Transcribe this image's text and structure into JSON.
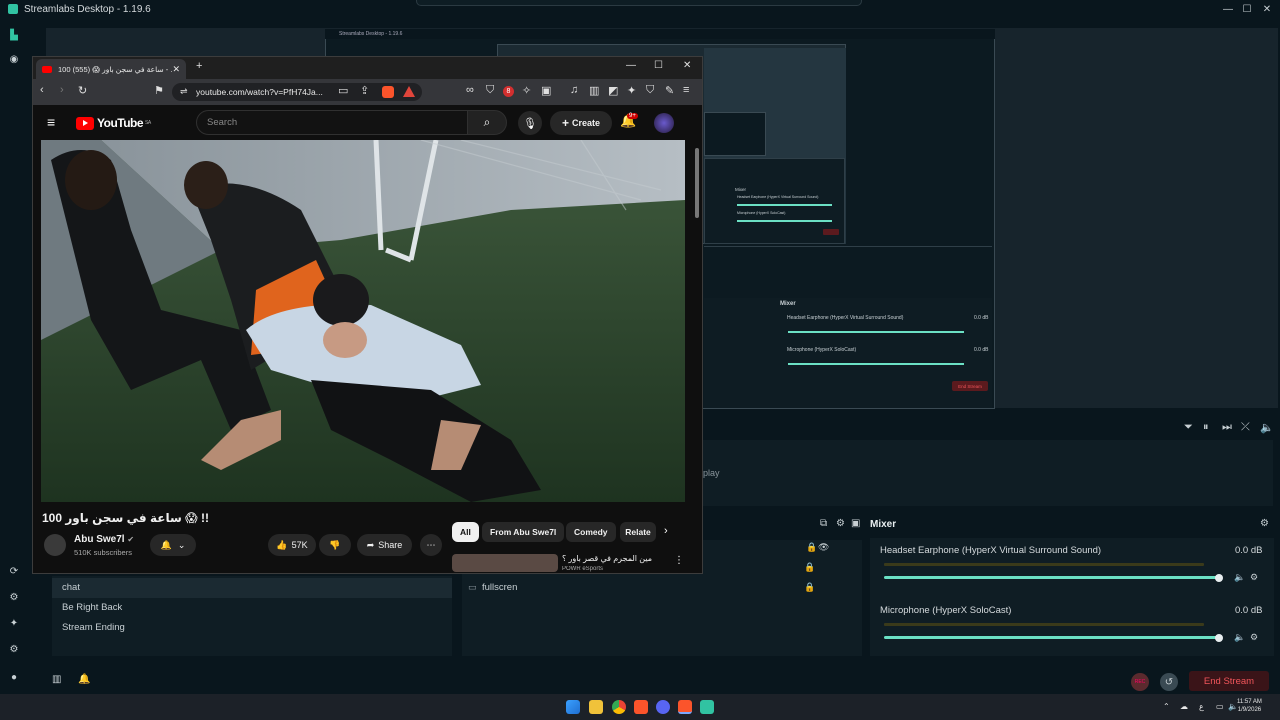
{
  "streamlabs": {
    "title": "Streamlabs Desktop - 1.19.6",
    "nested_title": "Streamlabs Desktop - 1.19.6",
    "scenes": [
      "chat",
      "Be Right Back",
      "Stream Ending"
    ],
    "sources": [
      {
        "label": "fullscren"
      }
    ],
    "sources_hint": "play",
    "mixer": {
      "title": "Mixer",
      "channels": [
        {
          "name": "Headset Earphone (HyperX Virtual Surround Sound)",
          "db": "0.0 dB",
          "level": 1.0
        },
        {
          "name": "Microphone (HyperX SoloCast)",
          "db": "0.0 dB",
          "level": 1.0
        }
      ]
    },
    "nested_mixer_title": "Mixer",
    "nested_channels": [
      "Headset Earphone (HyperX Virtual Surround Sound)",
      "Microphone (HyperX SoloCast)"
    ],
    "nested_db": "0.0 dB",
    "end_stream": "End Stream",
    "rec": "REC"
  },
  "browser": {
    "tab_title": "100 ساعة في سجن باور 😱 (555) - ...",
    "url": "youtube.com/watch?v=PfH74Ja...",
    "new_tab": "+",
    "extension_badge": "8"
  },
  "youtube": {
    "logo": "YouTube",
    "region": "SA",
    "search_placeholder": "Search",
    "create": "Create",
    "notif_count": "9+",
    "video_title": "100 ساعة في سجن باور 😱 !!",
    "channel": "Abu Swe7l",
    "subscribers": "510K subscribers",
    "likes": "57K",
    "share": "Share",
    "chips": [
      "All",
      "From Abu Swe7l",
      "Comedy",
      "Relate"
    ],
    "related_title": "مين المجرم في قصر باور ؟",
    "related_channel": "POWR eSports"
  },
  "clock": {
    "time": "11:57 AM",
    "date": "1/9/2026"
  },
  "tray": {
    "lang": "ع"
  }
}
